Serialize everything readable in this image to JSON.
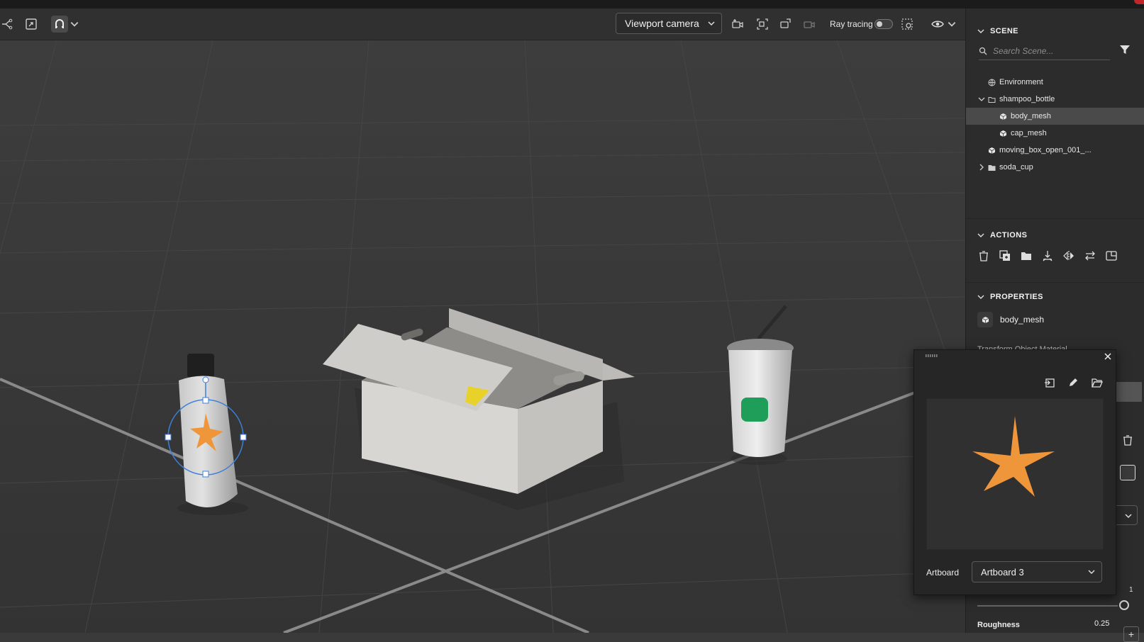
{
  "toolbar": {
    "camera_select": "Viewport camera",
    "ray_tracing_label": "Ray tracing",
    "ray_tracing_on": false
  },
  "scene_panel": {
    "title": "SCENE",
    "search_placeholder": "Search Scene...",
    "items": [
      {
        "label": "Environment",
        "icon": "globe-icon"
      },
      {
        "label": "shampoo_bottle",
        "icon": "folder-icon",
        "expanded": true
      },
      {
        "label": "body_mesh",
        "icon": "mesh-icon",
        "selected": true
      },
      {
        "label": "cap_mesh",
        "icon": "mesh-icon"
      },
      {
        "label": "moving_box_open_001_...",
        "icon": "mesh-icon"
      },
      {
        "label": "soda_cup",
        "icon": "folder-icon",
        "expanded": false
      }
    ]
  },
  "actions_panel": {
    "title": "ACTIONS",
    "icons": [
      "delete-icon",
      "duplicate-icon",
      "group-folder-icon",
      "drop-to-ground-icon",
      "mirror-icon",
      "swap-icon",
      "frame-icon"
    ]
  },
  "properties_panel": {
    "title": "PROPERTIES",
    "object_name": "body_mesh",
    "tabs_partial": "Transform  Object  Material",
    "slider_value": "1",
    "roughness_label": "Roughness",
    "roughness_value": "0.25"
  },
  "artboard_popup": {
    "artboard_label": "Artboard",
    "artboard_value": "Artboard 3",
    "decal_color": "#f0963a"
  }
}
